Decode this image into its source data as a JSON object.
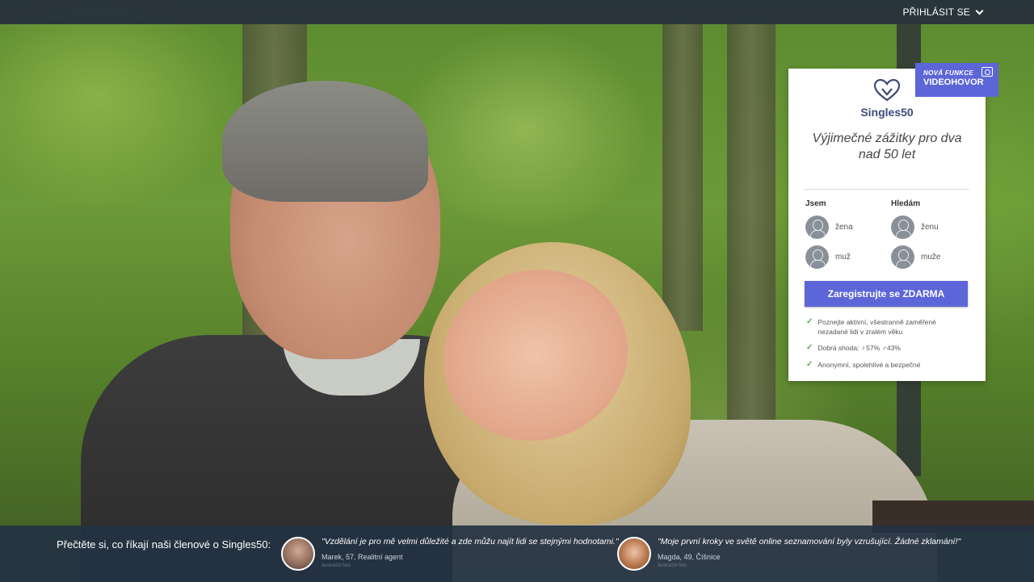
{
  "header": {
    "login_label": "PŘIHLÁSIT SE"
  },
  "badge": {
    "line1": "NOVÁ FUNKCE",
    "line2": "VIDEOHOVOR"
  },
  "card": {
    "brand": "Singles50",
    "tagline": "Výjimečné zážitky pro dva nad 50 let",
    "i_am": {
      "title": "Jsem",
      "options": [
        "žena",
        "muž"
      ]
    },
    "looking_for": {
      "title": "Hledám",
      "options": [
        "ženu",
        "muže"
      ]
    },
    "cta_label": "Zaregistrujte se ZDARMA",
    "features": [
      "Poznejte aktivní, všestranně zaměřené nezadané lidi v zralém věku",
      "Dobrá shoda: ♀57% ♂43%",
      "Anonymní, spolehlivé a bezpečné"
    ]
  },
  "testimonials": {
    "title": "Přečtěte si, co říkají naši členové o Singles50:",
    "items": [
      {
        "quote": "\"Vzdělání je pro mě velmi důležité a zde můžu najít lidi se stejnými hodnotami.\"",
        "author": "Marek, 57, Realitní agent",
        "note": "Ilustrační foto"
      },
      {
        "quote": "\"Moje první kroky ve světě online seznamování byly vzrušující. Žádné zklamání!\"",
        "author": "Magda, 49, Číšnice",
        "note": "Ilustrační foto"
      }
    ]
  },
  "colors": {
    "accent": "#5c66d8",
    "topbar": "#26303c",
    "check": "#4caf50"
  }
}
